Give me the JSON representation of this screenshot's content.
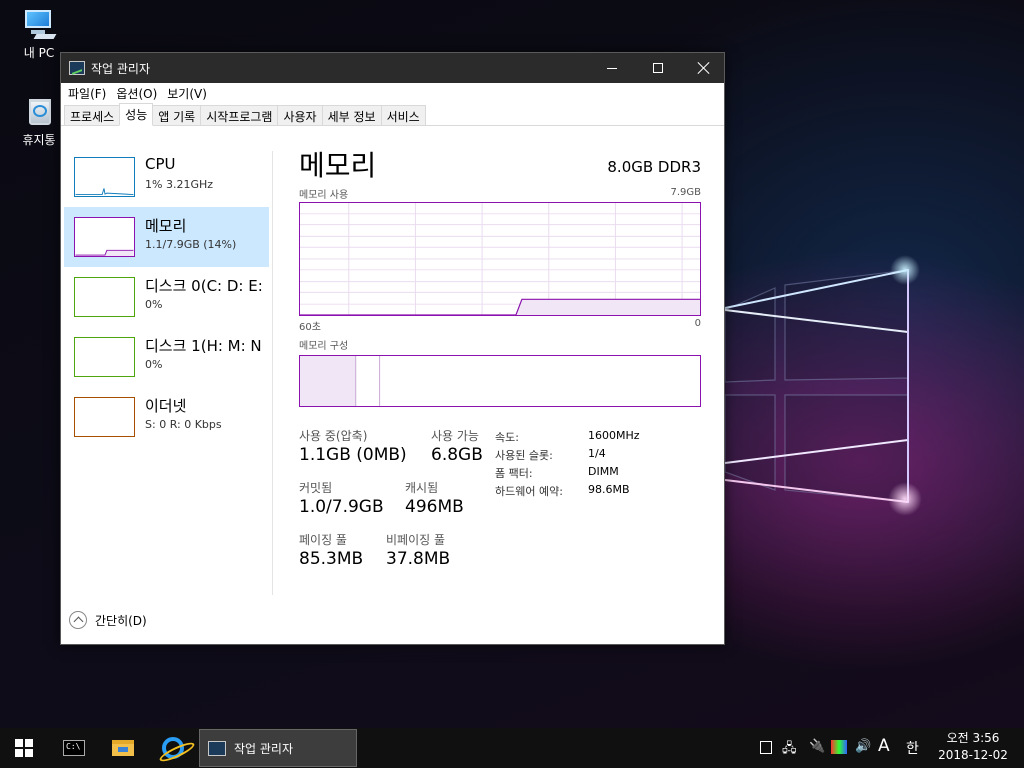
{
  "desktop": {
    "icons": [
      {
        "label": "내 PC"
      },
      {
        "label": "휴지통"
      }
    ]
  },
  "window": {
    "title": "작업 관리자",
    "menu": [
      "파일(F)",
      "옵션(O)",
      "보기(V)"
    ],
    "tabs": [
      "프로세스",
      "성능",
      "앱 기록",
      "시작프로그램",
      "사용자",
      "세부 정보",
      "서비스"
    ],
    "active_tab": "성능"
  },
  "sidebar": {
    "items": [
      {
        "name": "CPU",
        "sub": "1% 3.21GHz",
        "color": "#117dbb"
      },
      {
        "name": "메모리",
        "sub": "1.1/7.9GB (14%)",
        "color": "#8b12ae",
        "selected": true
      },
      {
        "name": "디스크 0(C: D: E:",
        "sub": "0%",
        "color": "#4da60c"
      },
      {
        "name": "디스크 1(H: M: N",
        "sub": "0%",
        "color": "#4da60c"
      },
      {
        "name": "이더넷",
        "sub_s": "S:",
        "sub_s_val": "0",
        "sub_r": "R:",
        "sub_r_val": "0 Kbps",
        "color": "#a74f01"
      }
    ]
  },
  "memory": {
    "title": "메모리",
    "spec": "8.0GB DDR3",
    "usage_label": "메모리 사용",
    "usage_max": "7.9GB",
    "time_left": "60초",
    "time_right": "0",
    "composition_label": "메모리 구성",
    "usage_fraction_recent": 0.14,
    "stats": {
      "in_use_label": "사용 중(압축)",
      "in_use_value": "1.1GB (0MB)",
      "available_label": "사용 가능",
      "available_value": "6.8GB",
      "committed_label": "커밋됨",
      "committed_value": "1.0/7.9GB",
      "cached_label": "캐시됨",
      "cached_value": "496MB",
      "paged_label": "페이징 풀",
      "paged_value": "85.3MB",
      "nonpaged_label": "비페이징 풀",
      "nonpaged_value": "37.8MB"
    },
    "details": [
      {
        "key": "속도:",
        "value": "1600MHz"
      },
      {
        "key": "사용된 슬롯:",
        "value": "1/4"
      },
      {
        "key": "폼 팩터:",
        "value": "DIMM"
      },
      {
        "key": "하드웨어 예약:",
        "value": "98.6MB"
      }
    ]
  },
  "footer": {
    "fewer_details": "간단히(D)"
  },
  "taskbar": {
    "active_task": "작업 관리자",
    "tray": {
      "ime_mode": "A",
      "ime_lang": "한"
    },
    "clock_time": "오전 3:56",
    "clock_date": "2018-12-02"
  }
}
